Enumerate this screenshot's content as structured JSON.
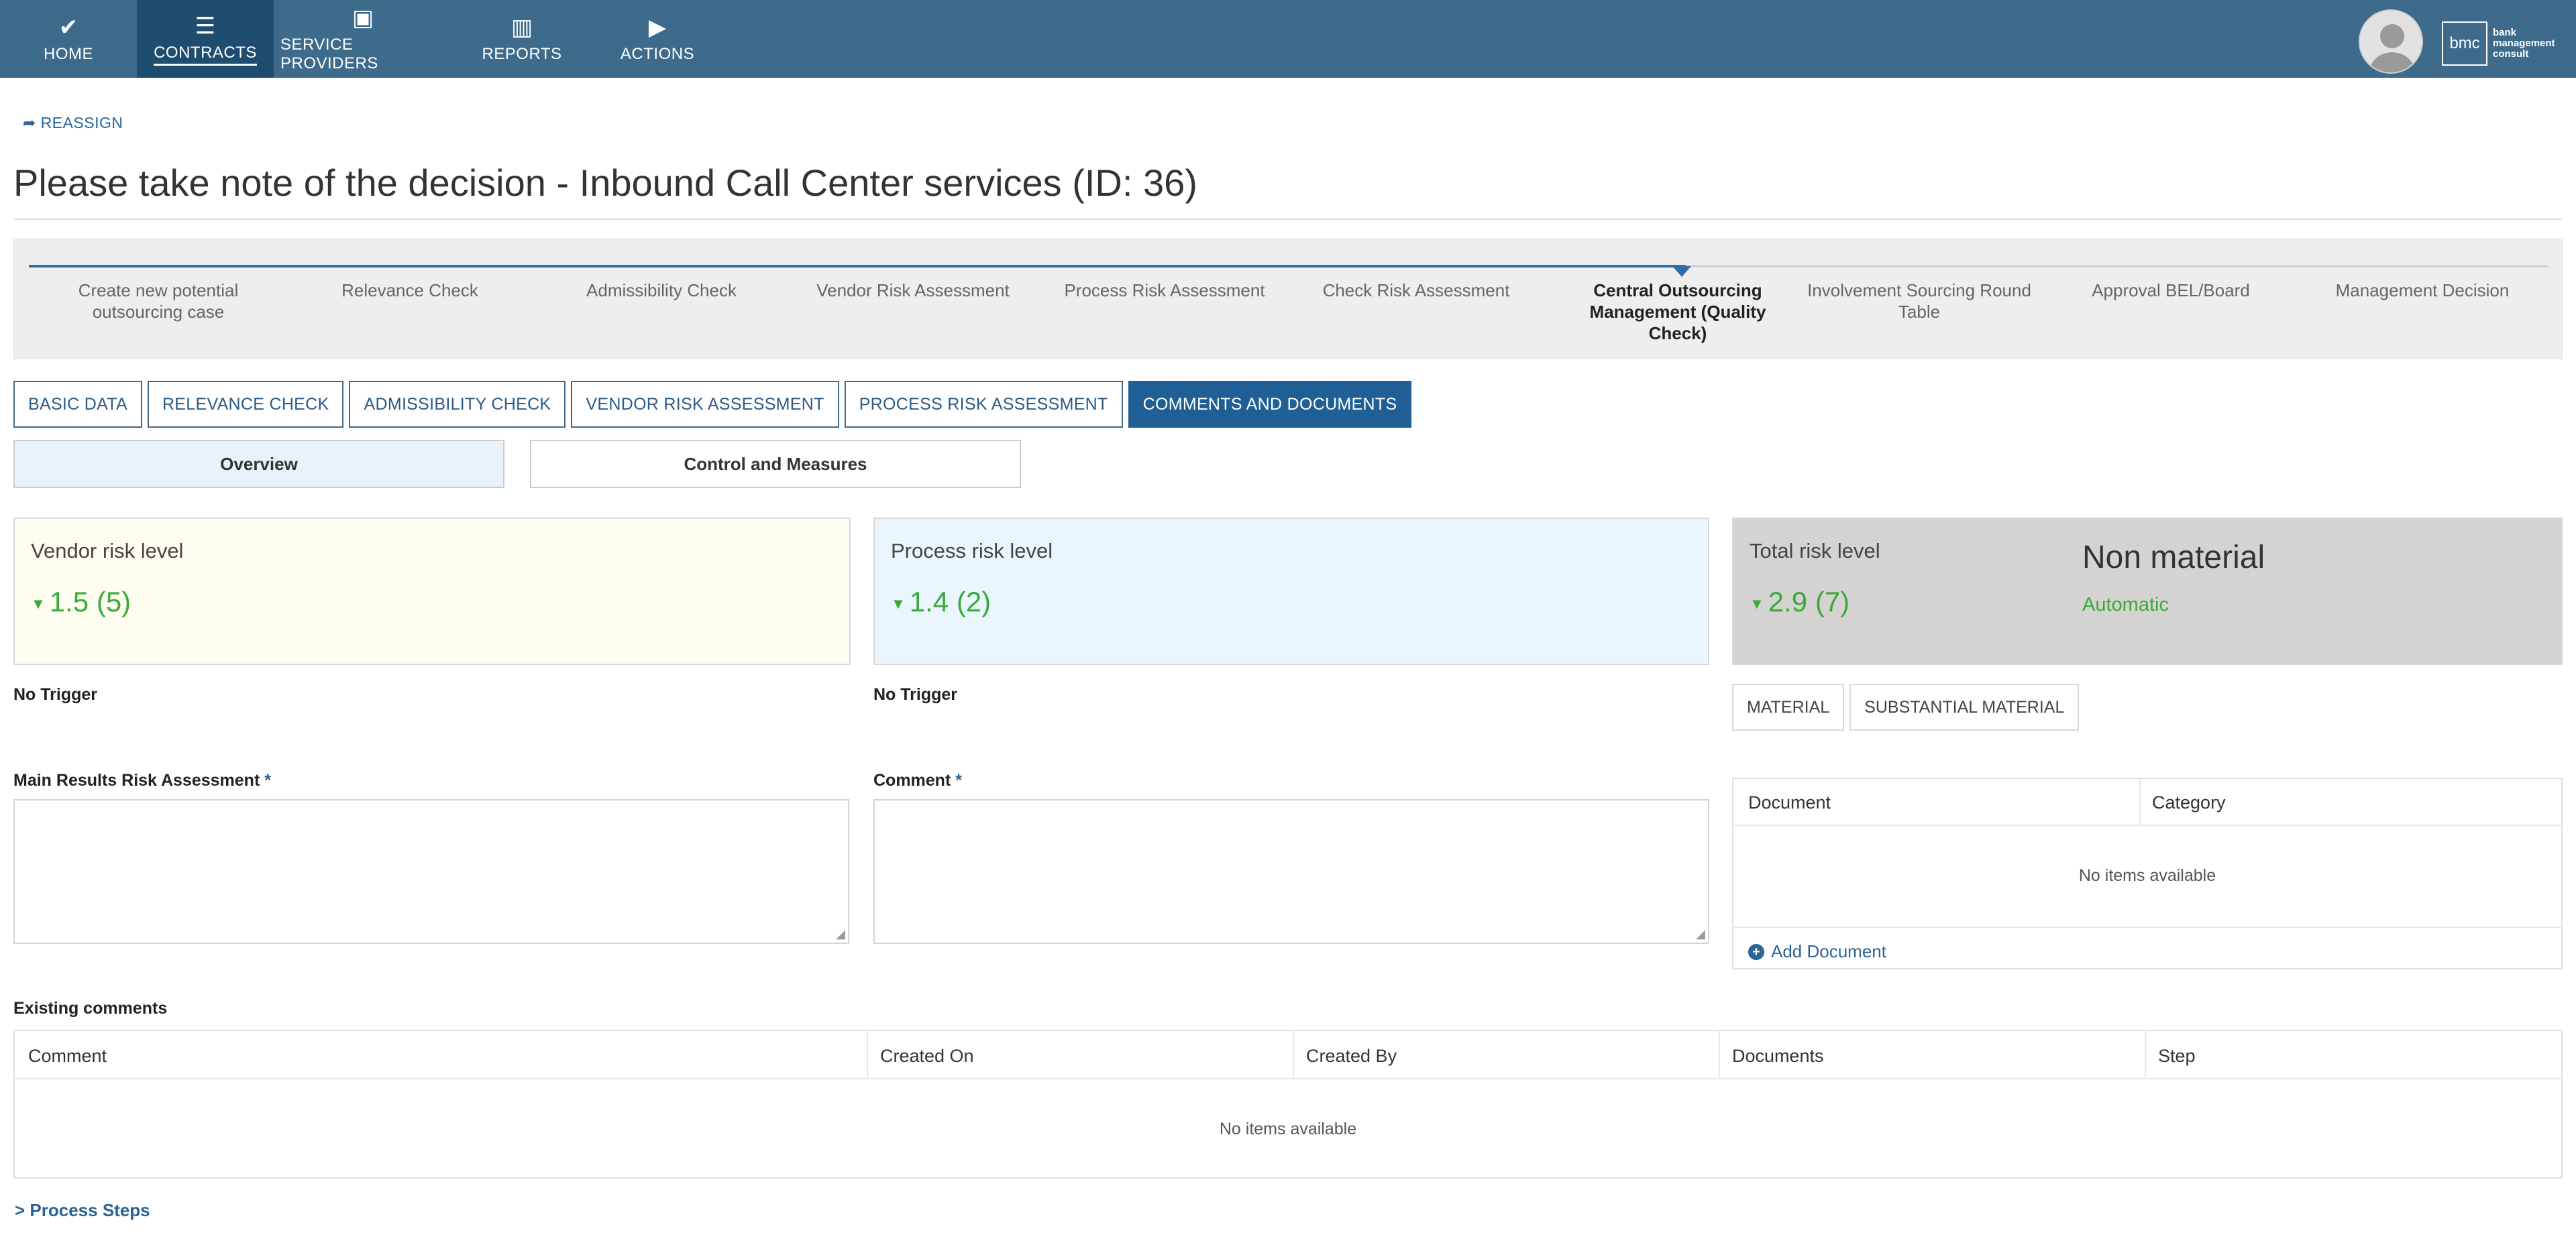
{
  "nav": {
    "items": [
      {
        "label": "HOME",
        "icon": "✔"
      },
      {
        "label": "CONTRACTS",
        "icon": "☰"
      },
      {
        "label": "SERVICE PROVIDERS",
        "icon": "▣"
      },
      {
        "label": "REPORTS",
        "icon": "▥"
      },
      {
        "label": "ACTIONS",
        "icon": "▶"
      }
    ],
    "logo_mark": "bmc",
    "logo_text": [
      "bank",
      "management",
      "consult"
    ]
  },
  "header": {
    "reassign_label": "REASSIGN",
    "title": "Please take note of the decision - Inbound Call Center services (ID: 36)"
  },
  "stepper": {
    "steps": [
      "Create new potential outsourcing case",
      "Relevance Check",
      "Admissibility Check",
      "Vendor Risk Assessment",
      "Process Risk Assessment",
      "Check Risk Assessment",
      "Central Outsourcing Management (Quality Check)",
      "Involvement Sourcing Round Table",
      "Approval BEL/Board",
      "Management Decision"
    ],
    "current_index": 6
  },
  "tabs": [
    "BASIC DATA",
    "RELEVANCE CHECK",
    "ADMISSIBILITY CHECK",
    "VENDOR RISK ASSESSMENT",
    "PROCESS RISK ASSESSMENT",
    "COMMENTS AND DOCUMENTS"
  ],
  "subtabs": [
    "Overview",
    "Control and Measures"
  ],
  "risk": {
    "vendor": {
      "title": "Vendor risk level",
      "value": "1.5 (5)",
      "trigger": "No Trigger"
    },
    "process": {
      "title": "Process risk level",
      "value": "1.4 (2)",
      "trigger": "No Trigger"
    },
    "total": {
      "title": "Total risk level",
      "value": "2.9 (7)",
      "materiality": "Non material",
      "mode": "Automatic"
    }
  },
  "materiality_buttons": [
    "MATERIAL",
    "SUBSTANTIAL MATERIAL"
  ],
  "fields": {
    "main_results_label": "Main Results Risk Assessment",
    "comment_label": "Comment",
    "required_mark": "*"
  },
  "documents": {
    "columns": [
      "Document",
      "Category"
    ],
    "empty_text": "No items available",
    "add_label": "Add Document"
  },
  "existing_comments": {
    "title": "Existing comments",
    "columns": [
      "Comment",
      "Created On",
      "Created By",
      "Documents",
      "Step"
    ],
    "empty_text": "No items available"
  },
  "process_steps_label": "Process Steps",
  "colors": {
    "nav_bg": "#3e6a8c",
    "nav_active": "#1f4d70",
    "tab_active": "#1f5f95",
    "risk_green": "#3aaa3a",
    "vendor_panel_bg": "#fffcf0",
    "process_panel_bg": "#eaf6fd",
    "total_panel_bg": "#d5d2d2"
  }
}
